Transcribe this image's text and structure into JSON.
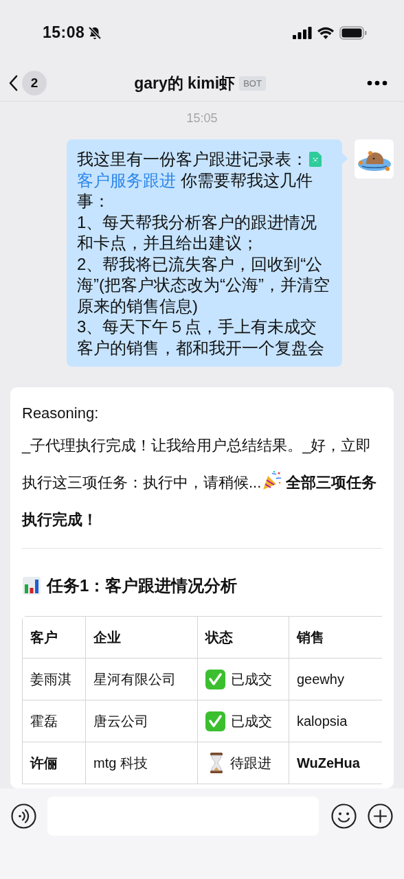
{
  "status_bar": {
    "time": "15:08",
    "muted": true
  },
  "nav": {
    "back_count": "2",
    "title": "gary的 kimi虾",
    "badge": "BOT"
  },
  "timestamp": "15:05",
  "user_message": {
    "intro": "我这里有一份客户跟进记录表：",
    "link": "客户服务跟进",
    "body": " 你需要帮我这几件事：\n1、每天帮我分析客户的跟进情况和卡点，并且给出建议；\n2、帮我将已流失客户，回收到“公海”(把客户状态改为“公海”，并清空原来的销售信息)\n3、每天下午５点，手上有未成交客户的销售，都和我开一个复盘会"
  },
  "reply": {
    "label": "Reasoning:",
    "text": "_子代理执行完成！让我给用户总结结果。_好，立即执行这三项任务：执行中，请稍候...",
    "text_after": "**全部三项任务执行完成！**",
    "heading": "任务1：客户跟进情况分析",
    "table": {
      "columns": [
        "客户",
        "企业",
        "状态",
        "销售"
      ],
      "rows": [
        {
          "cells": [
            "姜雨淇",
            "星河有限公司",
            "已成交",
            "geewhy"
          ],
          "kind": "done",
          "bold": false
        },
        {
          "cells": [
            "霍磊",
            "唐云公司",
            "已成交",
            "kalopsia"
          ],
          "kind": "done",
          "bold": false
        },
        {
          "cells": [
            "许俪",
            "mtg 科技",
            "待跟进",
            "WuZeHua"
          ],
          "kind": "pending",
          "bold": true
        }
      ]
    }
  }
}
